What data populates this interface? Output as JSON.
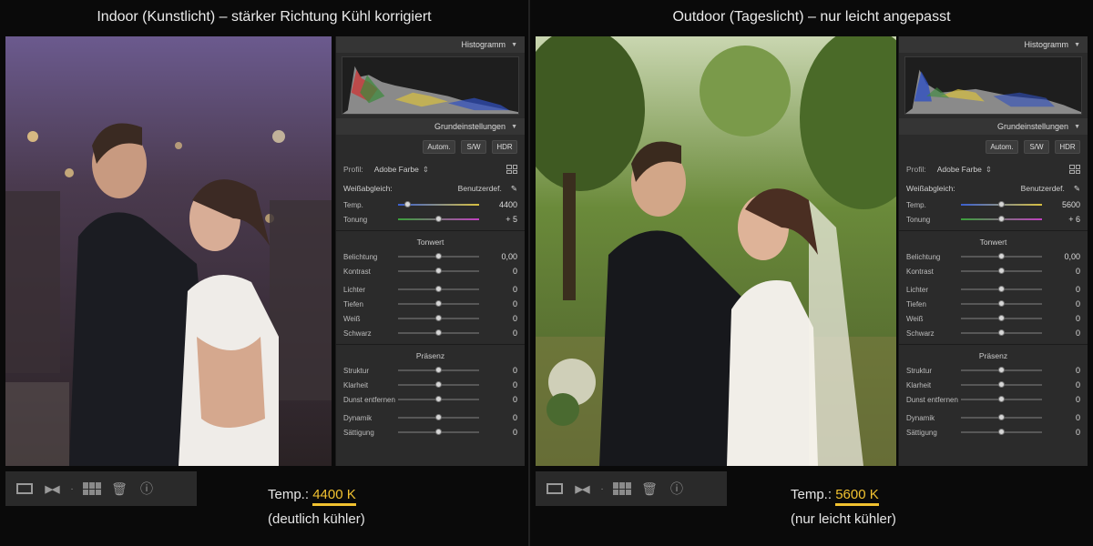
{
  "left": {
    "caption": "Indoor (Kunstlicht) – stärker Richtung Kühl korrigiert",
    "panel": {
      "histogram_title": "Histogramm",
      "basic_title": "Grundeinstellungen",
      "buttons": [
        "Autom.",
        "S/W",
        "HDR"
      ],
      "profile_label": "Profil:",
      "profile_value": "Adobe Farbe",
      "wb_label": "Weißabgleich:",
      "wb_value": "Benutzerdef.",
      "temp": {
        "label": "Temp.",
        "value": "4400",
        "level": 0.12
      },
      "tint": {
        "label": "Tonung",
        "value": "+ 5",
        "level": 0.5
      },
      "tone_title": "Tonwert",
      "tone": [
        {
          "label": "Belichtung",
          "value": "0,00",
          "level": 0.5
        },
        {
          "label": "Kontrast",
          "value": "0",
          "level": 0.5
        },
        {
          "label": "Lichter",
          "value": "0",
          "level": 0.5
        },
        {
          "label": "Tiefen",
          "value": "0",
          "level": 0.5
        },
        {
          "label": "Weiß",
          "value": "0",
          "level": 0.5
        },
        {
          "label": "Schwarz",
          "value": "0",
          "level": 0.5
        }
      ],
      "presence_title": "Präsenz",
      "presence": [
        {
          "label": "Struktur",
          "value": "0",
          "level": 0.5
        },
        {
          "label": "Klarheit",
          "value": "0",
          "level": 0.5
        },
        {
          "label": "Dunst entfernen",
          "value": "0",
          "level": 0.5
        },
        {
          "label": "Dynamik",
          "value": "0",
          "level": 0.5
        },
        {
          "label": "Sättigung",
          "value": "0",
          "level": 0.5
        }
      ]
    },
    "temp_prefix": "Temp.:",
    "temp_display": "4400 K",
    "temp_note": "(deutlich kühler)"
  },
  "right": {
    "caption": "Outdoor (Tageslicht) – nur leicht angepasst",
    "panel": {
      "histogram_title": "Histogramm",
      "basic_title": "Grundeinstellungen",
      "buttons": [
        "Autom.",
        "S/W",
        "HDR"
      ],
      "profile_label": "Profil:",
      "profile_value": "Adobe Farbe",
      "wb_label": "Weißabgleich:",
      "wb_value": "Benutzerdef.",
      "temp": {
        "label": "Temp.",
        "value": "5600",
        "level": 0.5
      },
      "tint": {
        "label": "Tonung",
        "value": "+ 6",
        "level": 0.5
      },
      "tone_title": "Tonwert",
      "tone": [
        {
          "label": "Belichtung",
          "value": "0,00",
          "level": 0.5
        },
        {
          "label": "Kontrast",
          "value": "0",
          "level": 0.5
        },
        {
          "label": "Lichter",
          "value": "0",
          "level": 0.5
        },
        {
          "label": "Tiefen",
          "value": "0",
          "level": 0.5
        },
        {
          "label": "Weiß",
          "value": "0",
          "level": 0.5
        },
        {
          "label": "Schwarz",
          "value": "0",
          "level": 0.5
        }
      ],
      "presence_title": "Präsenz",
      "presence": [
        {
          "label": "Struktur",
          "value": "0",
          "level": 0.5
        },
        {
          "label": "Klarheit",
          "value": "0",
          "level": 0.5
        },
        {
          "label": "Dunst entfernen",
          "value": "0",
          "level": 0.5
        },
        {
          "label": "Dynamik",
          "value": "0",
          "level": 0.5
        },
        {
          "label": "Sättigung",
          "value": "0",
          "level": 0.5
        }
      ]
    },
    "temp_prefix": "Temp.:",
    "temp_display": "5600 K",
    "temp_note": "(nur leicht kühler)"
  },
  "colors": {
    "accent": "#f2c230",
    "panel_bg": "#2b2b2b"
  },
  "icons": [
    "loupe-view-icon",
    "compare-view-icon",
    "grid-view-icon",
    "trash-icon",
    "info-icon",
    "eyedropper-icon",
    "profile-grid-icon"
  ]
}
